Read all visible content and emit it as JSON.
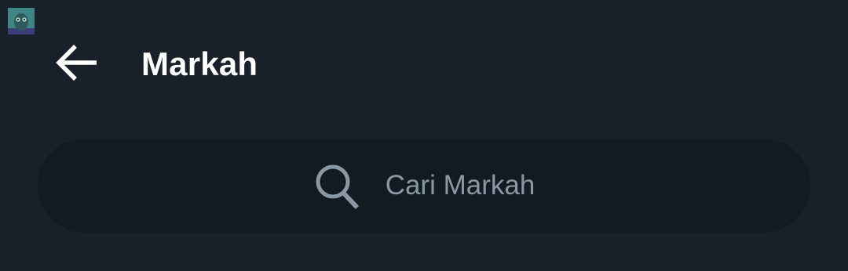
{
  "header": {
    "title": "Markah",
    "back_icon": "arrow-left-icon"
  },
  "search": {
    "placeholder": "Cari Markah",
    "icon": "search-icon"
  },
  "avatar": {
    "icon": "avatar-owl"
  },
  "colors": {
    "background": "#18202a",
    "search_background": "#121a22",
    "title": "#ffffff",
    "placeholder": "#8a98a4"
  }
}
